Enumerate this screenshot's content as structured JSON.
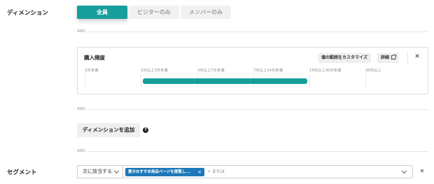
{
  "dimension": {
    "label": "ディメンション",
    "tabs": [
      {
        "label": "全員",
        "active": true
      },
      {
        "label": "ビジターのみ",
        "active": false
      },
      {
        "label": "メンバーのみ",
        "active": false
      }
    ]
  },
  "and_label": "AND",
  "filter_card": {
    "title": "購入頻度",
    "customize_button": "値の範囲をカスタマイズ",
    "detail_button": "詳細",
    "close_symbol": "✕",
    "ticks": [
      "1日未満",
      "1日以上3日未満",
      "3日以上7日未満",
      "7日以上14日未満",
      "14日以上30日未満",
      "30日以上"
    ],
    "range": {
      "start_tick": 1,
      "end_tick": 4,
      "color": "#179e9a"
    }
  },
  "add_dimension_button": "ディメンションを追加",
  "help_symbol": "?",
  "segment": {
    "label": "セグメント",
    "operator": "次に該当する",
    "chip_label": "夏のおすすめ商品ページを閲覧し...",
    "chip_remove": "✕",
    "or_text": "+ または",
    "close_symbol": "✕"
  },
  "colors": {
    "accent": "#179e9a",
    "chip": "#1c78b8"
  }
}
